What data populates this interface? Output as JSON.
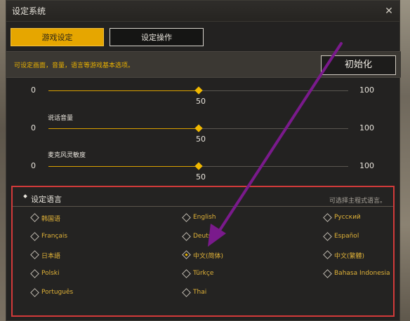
{
  "window": {
    "title": "设定系统",
    "close_label": "✕"
  },
  "tabs": [
    {
      "label": "游戏设定",
      "active": true
    },
    {
      "label": "设定操作",
      "active": false
    }
  ],
  "info": {
    "text": "可设定画面，音量，语言等游戏基本选项。",
    "init_button": "初始化"
  },
  "sliders": [
    {
      "label": "",
      "min": "0",
      "max": "100",
      "value": "50",
      "fraction": 0.5
    },
    {
      "label": "说话音量",
      "min": "0",
      "max": "100",
      "value": "50",
      "fraction": 0.5
    },
    {
      "label": "麦克风灵敏度",
      "min": "0",
      "max": "100",
      "value": "50",
      "fraction": 0.5
    }
  ],
  "language": {
    "title": "设定语言",
    "hint": "可选择主程式语言。",
    "items": [
      {
        "label": "韩国语",
        "selected": false
      },
      {
        "label": "English",
        "selected": false
      },
      {
        "label": "Русский",
        "selected": false
      },
      {
        "label": "Français",
        "selected": false
      },
      {
        "label": "Deutsch",
        "selected": false
      },
      {
        "label": "Español",
        "selected": false
      },
      {
        "label": "日本語",
        "selected": false
      },
      {
        "label": "中文(简体)",
        "selected": true
      },
      {
        "label": "中文(繁體)",
        "selected": false
      },
      {
        "label": "Polski",
        "selected": false
      },
      {
        "label": "Türkçe",
        "selected": false
      },
      {
        "label": "Bahasa Indonesia",
        "selected": false
      },
      {
        "label": "Português",
        "selected": false
      },
      {
        "label": "Thai",
        "selected": false
      }
    ]
  },
  "colors": {
    "accent": "#e6a600",
    "annotation_box": "#d23a3a",
    "annotation_arrow": "#7a1a8c"
  }
}
